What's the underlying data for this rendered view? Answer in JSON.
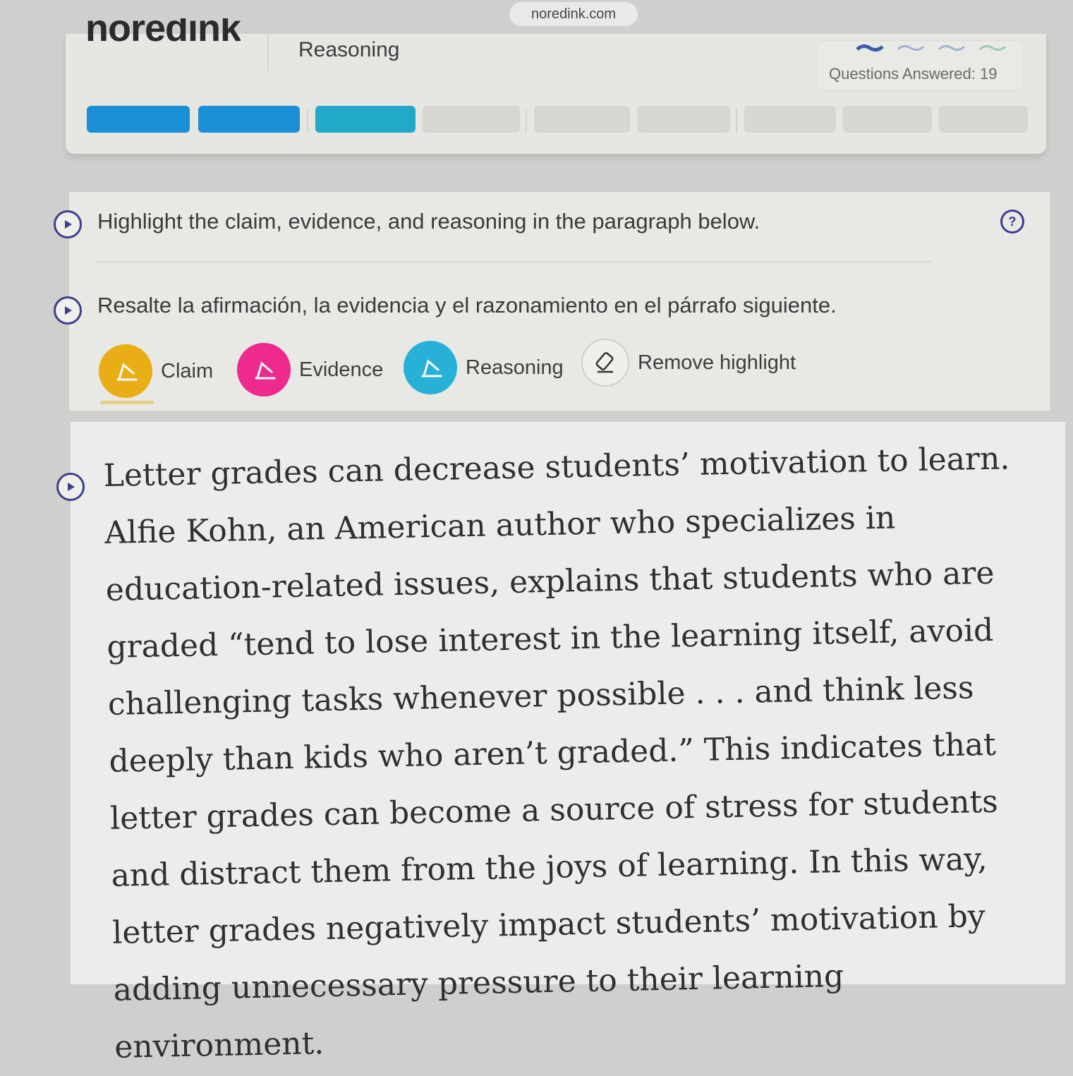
{
  "browser": {
    "url": "noredink.com"
  },
  "header": {
    "logo_text": "noredink",
    "subject": "Reasoning",
    "questions_answered": "Questions Answered: 19",
    "progress": {
      "completed_segments": 3,
      "total_segments": 9
    }
  },
  "instructions": {
    "english": "Highlight the claim, evidence, and reasoning in the paragraph below.",
    "spanish": "Resalte la afirmación, la evidencia y el razonamiento en el párrafo siguiente.",
    "help_label": "?"
  },
  "tools": {
    "claim": {
      "label": "Claim",
      "color": "#e9ad16"
    },
    "evidence": {
      "label": "Evidence",
      "color": "#ee2a8c"
    },
    "reasoning": {
      "label": "Reasoning",
      "color": "#27b1d6"
    },
    "remove": {
      "label": "Remove highlight"
    }
  },
  "paragraph": {
    "text": "Letter grades can decrease students’ motivation to learn. Alfie Kohn, an American author who specializes in education-related issues, explains that students who are graded “tend to lose interest in the learning itself, avoid challenging tasks whenever possible . . . and think less deeply than kids who aren’t graded.” This indicates that letter grades can become a source of stress for students and distract them from the joys of learning. In this way, letter grades negatively impact students’ motivation by adding unnecessary pressure to their learning environment."
  },
  "colors": {
    "progress_complete": "#1b8fd6",
    "progress_current": "#22a9c9",
    "progress_empty": "#d6d6d3",
    "audio_icon": "#3b3f8f"
  }
}
